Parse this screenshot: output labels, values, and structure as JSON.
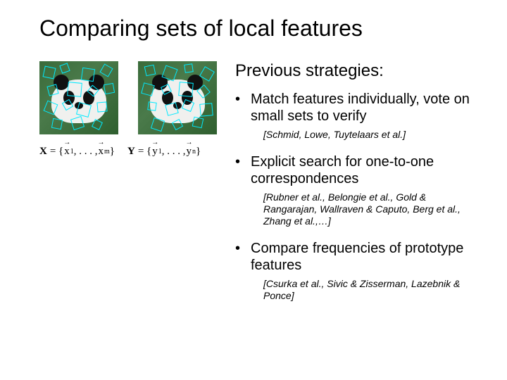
{
  "title": "Comparing sets of local features",
  "subtitle": "Previous strategies:",
  "set_x": {
    "label": "X",
    "open": "= {",
    "v1": "x",
    "s1": "1",
    "mid": ", . . . ,",
    "v2": "x",
    "s2": "m",
    "close": "}"
  },
  "set_y": {
    "label": "Y",
    "open": "= {",
    "v1": "y",
    "s1": "1",
    "mid": ", . . . ,",
    "v2": "y",
    "s2": "n",
    "close": "}"
  },
  "bullets": [
    {
      "text": "Match features individually, vote on small sets to verify",
      "cite": "[Schmid, Lowe, Tuytelaars et al.]"
    },
    {
      "text": "Explicit search for one-to-one correspondences",
      "cite": "[Rubner et al., Belongie et al., Gold & Rangarajan, Wallraven & Caputo, Berg et al., Zhang et al.,…]"
    },
    {
      "text": "Compare frequencies of prototype features",
      "cite": "[Csurka et al., Sivic & Zisserman, Lazebnik & Ponce]"
    }
  ]
}
